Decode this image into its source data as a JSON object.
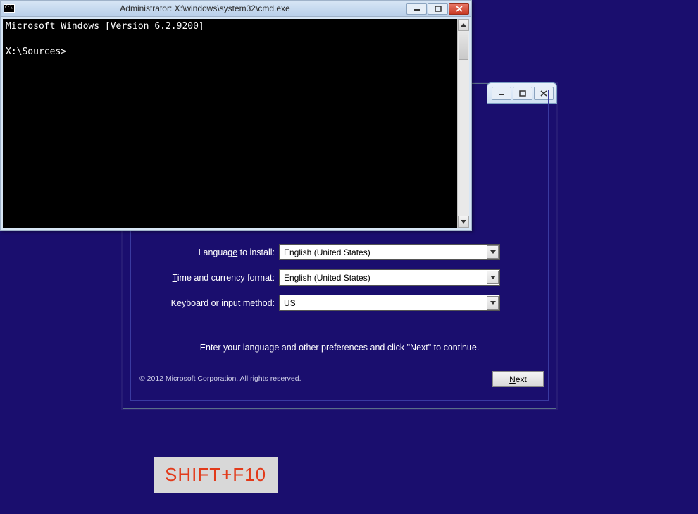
{
  "setup": {
    "fields": {
      "language": {
        "label_pre": "Languag",
        "label_u": "e",
        "label_post": " to install:",
        "value": "English (United States)"
      },
      "timefmt": {
        "label_pre": "",
        "label_u": "T",
        "label_post": "ime and currency format:",
        "value": "English (United States)"
      },
      "keyboard": {
        "label_pre": "",
        "label_u": "K",
        "label_post": "eyboard or input method:",
        "value": "US"
      }
    },
    "instruction": "Enter your language and other preferences and click \"Next\" to continue.",
    "copyright": "© 2012 Microsoft Corporation. All rights reserved.",
    "next_pre": "",
    "next_u": "N",
    "next_post": "ext"
  },
  "cmd": {
    "title": "Administrator: X:\\windows\\system32\\cmd.exe",
    "line1": "Microsoft Windows [Version 6.2.9200]",
    "prompt": "X:\\Sources>"
  },
  "annotation": "SHIFT+F10"
}
